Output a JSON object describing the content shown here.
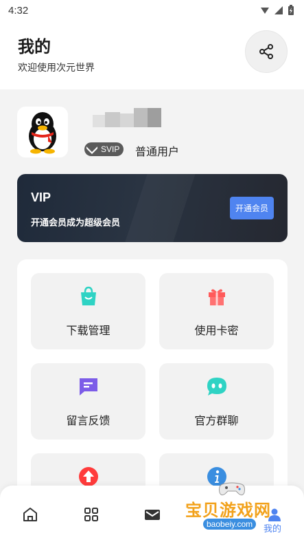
{
  "status_bar": {
    "time": "4:32"
  },
  "header": {
    "title": "我的",
    "subtitle": "欢迎使用次元世界"
  },
  "profile": {
    "badge": "SVIP",
    "level": "普通用户"
  },
  "vip_card": {
    "title": "VIP",
    "description": "开通会员成为超级会员",
    "button_label": "开通会员"
  },
  "menu": {
    "items": [
      {
        "label": "下载管理",
        "icon": "shopping-bag-icon",
        "color": "#2fd3c4"
      },
      {
        "label": "使用卡密",
        "icon": "gift-icon",
        "color": "#ff5a5a"
      },
      {
        "label": "留言反馈",
        "icon": "message-icon",
        "color": "#7c5ce8"
      },
      {
        "label": "官方群聊",
        "icon": "chat-face-icon",
        "color": "#2fd3c4"
      },
      {
        "label": "",
        "icon": "upload-icon",
        "color": "#ff3b3b"
      },
      {
        "label": "",
        "icon": "info-icon",
        "color": "#3a8ee0"
      }
    ]
  },
  "bottom_nav": {
    "items": [
      {
        "icon": "home-icon"
      },
      {
        "icon": "apps-grid-icon"
      },
      {
        "icon": "mail-icon"
      },
      {
        "icon": "profile-icon"
      }
    ],
    "active_label": "我的"
  },
  "watermark": {
    "title": "宝贝游戏网",
    "url": "baobeiy.com"
  },
  "colors": {
    "accent": "#4f84f0",
    "vip_card_bg": "#232b37",
    "page_bg": "#f3f3f3"
  }
}
